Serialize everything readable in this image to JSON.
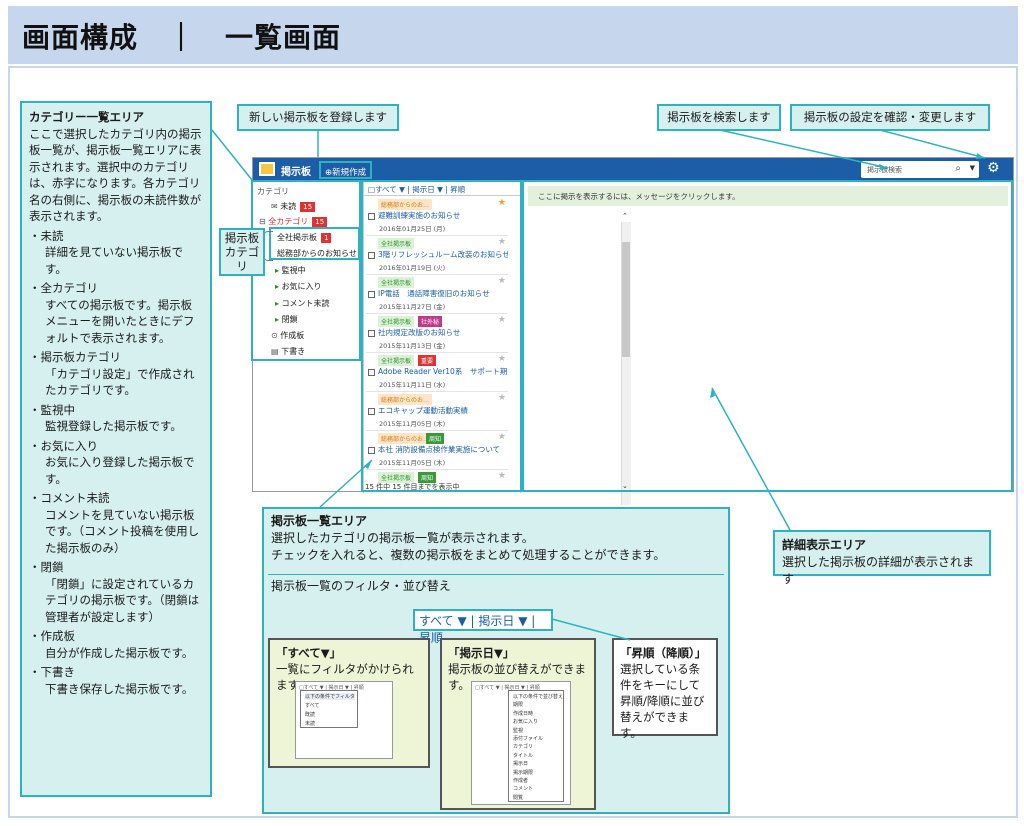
{
  "page": {
    "title": "画面構成　｜　一覧画面"
  },
  "callouts": {
    "category_area": {
      "title": "カテゴリー一覧エリア",
      "desc": "ここで選択したカテゴリ内の掲示板一覧が、掲示板一覧エリアに表示されます。選択中のカテゴリは、赤字になります。各カテゴリ名の右側に、掲示板の未読件数が表示されます。",
      "items": [
        {
          "name": "・未読",
          "desc": "詳細を見ていない掲示板です。"
        },
        {
          "name": "・全カテゴリ",
          "desc": "すべての掲示板です。掲示板メニューを開いたときにデフォルトで表示されます。"
        },
        {
          "name": "・掲示板カテゴリ",
          "desc": "「カテゴリ設定」で作成されたカテゴリです。"
        },
        {
          "name": "・監視中",
          "desc": "監視登録した掲示板です。"
        },
        {
          "name": "・お気に入り",
          "desc": "お気に入り登録した掲示板です。"
        },
        {
          "name": "・コメント未読",
          "desc": "コメントを見ていない掲示板です。（コメント投稿を使用した掲示板のみ）"
        },
        {
          "name": "・閉鎖",
          "desc": "「閉鎖」に設定されているカテゴリの掲示板です。（閉鎖は管理者が設定します）"
        },
        {
          "name": "・作成板",
          "desc": "自分が作成した掲示板です。"
        },
        {
          "name": "・下書き",
          "desc": "下書き保存した掲示板です。"
        }
      ]
    },
    "new_board": "新しい掲示板を登録します",
    "search": "掲示板を検索します",
    "settings": "掲示板の設定を確認・変更します",
    "board_cat_tag": "掲示板カテゴリ",
    "list_area": {
      "title": "掲示板一覧エリア",
      "desc1": "選択したカテゴリの掲示板一覧が表示されます。",
      "desc2": "チェックを入れると、複数の掲示板をまとめて処理することができます。",
      "filter_title": "掲示板一覧のフィルタ・並び替え",
      "sort_bar": "すべて ▼ | 掲示日 ▼ | 昇順"
    },
    "all_filter": {
      "title": "「すべて▼」",
      "desc": "一覧にフィルタがかけられます。"
    },
    "date_sort": {
      "title": "「掲示日▼」",
      "desc": "掲示板の並び替えができます。"
    },
    "order": {
      "title": "「昇順（降順）」",
      "desc": "選択している条件をキーにして昇順/降順に並び替えができます。"
    },
    "detail_area": {
      "title": "詳細表示エリア",
      "desc": "選択した掲示板の詳細が表示されます"
    }
  },
  "app": {
    "brand": "掲示板",
    "new_button": "⊕新規作成",
    "search_placeholder": "掲示板検索",
    "categories": [
      {
        "label": "カテゴリ",
        "count": ""
      },
      {
        "label": "未読",
        "count": "15"
      },
      {
        "label": "全カテゴリ",
        "count": "15"
      },
      {
        "label": "全社掲示板",
        "count": "1"
      },
      {
        "label": "総務部からのお知らせ",
        "count": ""
      },
      {
        "label": "監視中",
        "count": ""
      },
      {
        "label": "お気に入り",
        "count": ""
      },
      {
        "label": "コメント未読",
        "count": ""
      },
      {
        "label": "閉鎖",
        "count": ""
      },
      {
        "label": "作成板",
        "count": ""
      },
      {
        "label": "下書き",
        "count": ""
      }
    ],
    "list_header": "□すべて ▼ | 掲示日 ▼ | 昇順",
    "items": [
      {
        "cat": "総務部からのお…",
        "status": "",
        "title": "避難訓練実施のお知らせ",
        "date": "2016年01月25日 (月)"
      },
      {
        "cat": "全社掲示板",
        "status": "",
        "title": "3階リフレッシュルーム改装のお知らせ",
        "date": "2016年01月19日 (火)"
      },
      {
        "cat": "全社掲示板",
        "status": "",
        "title": "IP電話　通話障害復旧のお知らせ",
        "date": "2015年11月27日 (金)"
      },
      {
        "cat": "全社掲示板",
        "status": "社外秘",
        "title": "社内規定改版のお知らせ",
        "date": "2015年11月13日 (金)"
      },
      {
        "cat": "全社掲示板",
        "status": "重要",
        "title": "Adobe Reader Ver10系　サポート期…",
        "date": "2015年11月11日 (水)"
      },
      {
        "cat": "総務部からのお…",
        "status": "",
        "title": "エコキャップ運動活動実績",
        "date": "2015年11月05日 (木)"
      },
      {
        "cat": "総務部からのお…",
        "status": "周知",
        "title": "本社 消防設備点検作業実施について",
        "date": "2015年11月05日 (木)"
      },
      {
        "cat": "全社掲示板",
        "status": "周知",
        "title": "",
        "date": ""
      }
    ],
    "list_footer": "15 件中 15 件目までを表示中",
    "detail_msg": "ここに掲示を表示するには、メッセージをクリックします。"
  },
  "mini_all": {
    "header": "□すべて ▼ | 掲示日 ▼ | 昇順",
    "popup": [
      "以下の条件でフィルタ",
      "すべて",
      "既読",
      "未読"
    ]
  },
  "mini_date": {
    "header": "□すべて ▼ | 掲示日 ▼ | 昇順",
    "popup": [
      "以下の条件で並び替え",
      "期限",
      "作成日時",
      "お気に入り",
      "監視",
      "添付ファイル",
      "カテゴリ",
      "タイトル",
      "掲示日",
      "掲示期限",
      "作成者",
      "コメント",
      "閲覧"
    ]
  },
  "colors": {
    "accent": "#2cb3bf",
    "nav": "#1b5ea7",
    "callout": "#d6efef",
    "title_bg": "#c6d6ec"
  }
}
